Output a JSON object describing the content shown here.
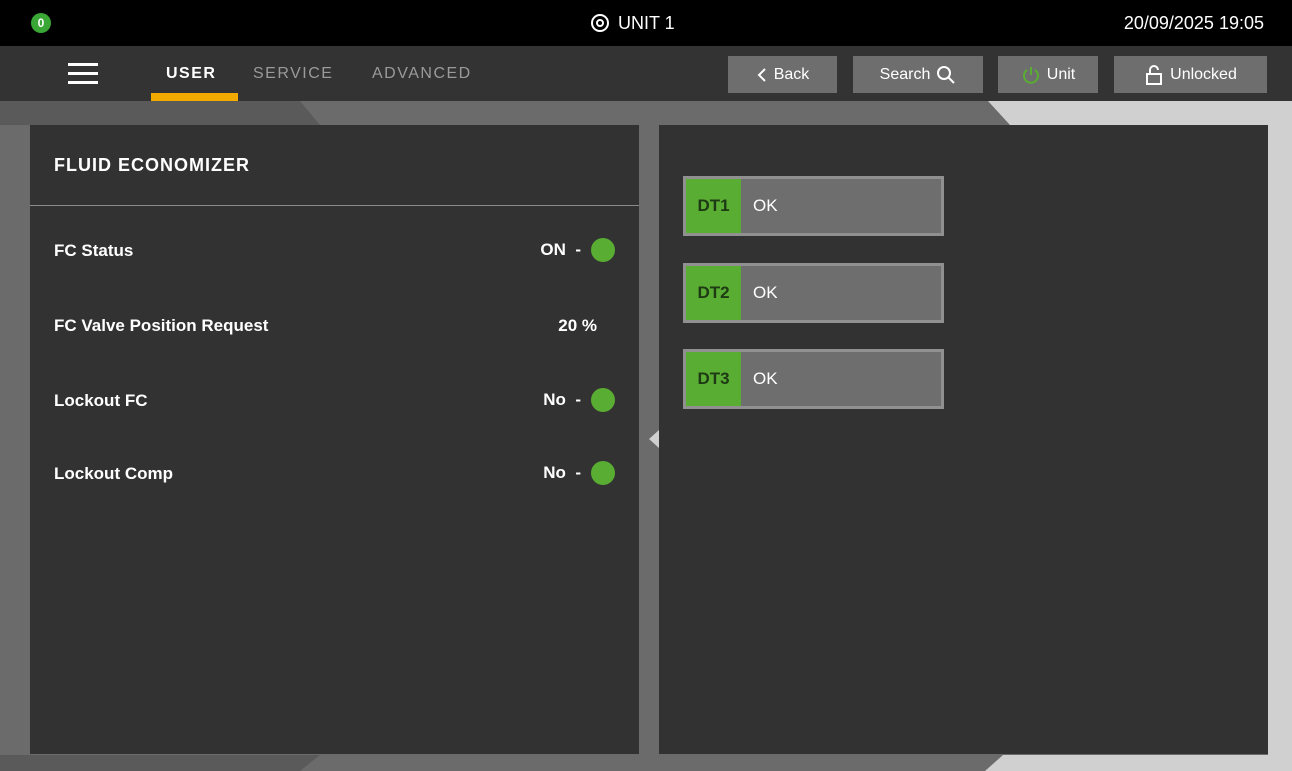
{
  "status_bar": {
    "alarm_count": "0",
    "unit_title": "UNIT 1",
    "datetime": "20/09/2025 19:05"
  },
  "nav": {
    "tabs": [
      {
        "label": "USER",
        "active": true
      },
      {
        "label": "SERVICE",
        "active": false
      },
      {
        "label": "ADVANCED",
        "active": false
      }
    ],
    "buttons": {
      "back": "Back",
      "search": "Search",
      "unit": "Unit",
      "lock": "Unlocked"
    }
  },
  "fluid_economizer": {
    "title": "FLUID ECONOMIZER",
    "rows": [
      {
        "label": "FC Status",
        "value": "ON  -",
        "indicator": "green"
      },
      {
        "label": "FC Valve Position Request",
        "value": "20 %",
        "indicator": null
      },
      {
        "label": "Lockout FC",
        "value": "No  -",
        "indicator": "green"
      },
      {
        "label": "Lockout Comp",
        "value": "No  -",
        "indicator": "green"
      }
    ]
  },
  "dt_sensors": [
    {
      "code": "DT1",
      "status": "OK"
    },
    {
      "code": "DT2",
      "status": "OK"
    },
    {
      "code": "DT3",
      "status": "OK"
    }
  ],
  "colors": {
    "accent": "#f2a900",
    "status_ok": "#5aad33",
    "panel_bg": "#323232",
    "button_bg": "#6e6e6e"
  }
}
